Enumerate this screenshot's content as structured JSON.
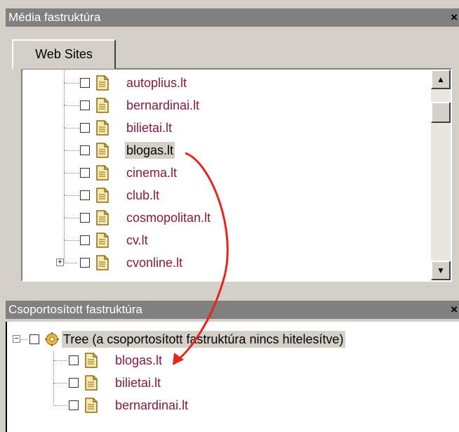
{
  "top_pane": {
    "title": "Média fastruktúra",
    "close": "×",
    "tab_label": "Web Sites",
    "items": [
      {
        "label": "autoplius.lt"
      },
      {
        "label": "bernardinai.lt"
      },
      {
        "label": "bilietai.lt"
      },
      {
        "label": "blogas.lt",
        "selected": true
      },
      {
        "label": "cinema.lt"
      },
      {
        "label": "club.lt"
      },
      {
        "label": "cosmopolitan.lt"
      },
      {
        "label": "cv.lt"
      },
      {
        "label": "cvonline.lt",
        "expandable": true
      }
    ],
    "scroll_up": "▲",
    "scroll_down": "▼"
  },
  "bottom_pane": {
    "title": "Csoportosított fastruktúra",
    "close": "×",
    "root_label": "Tree (a csoportosított fastruktúra nincs hitelesítve)",
    "items": [
      {
        "label": "blogas.lt"
      },
      {
        "label": "bilietai.lt"
      },
      {
        "label": "bernardinai.lt"
      }
    ]
  },
  "colors": {
    "link": "#8b1a3a",
    "arrow": "#e8241c",
    "title_bar": "#808080"
  },
  "icons": [
    "page-icon",
    "gear-icon",
    "expand-icon",
    "collapse-icon",
    "scroll-up-icon",
    "scroll-down-icon"
  ]
}
